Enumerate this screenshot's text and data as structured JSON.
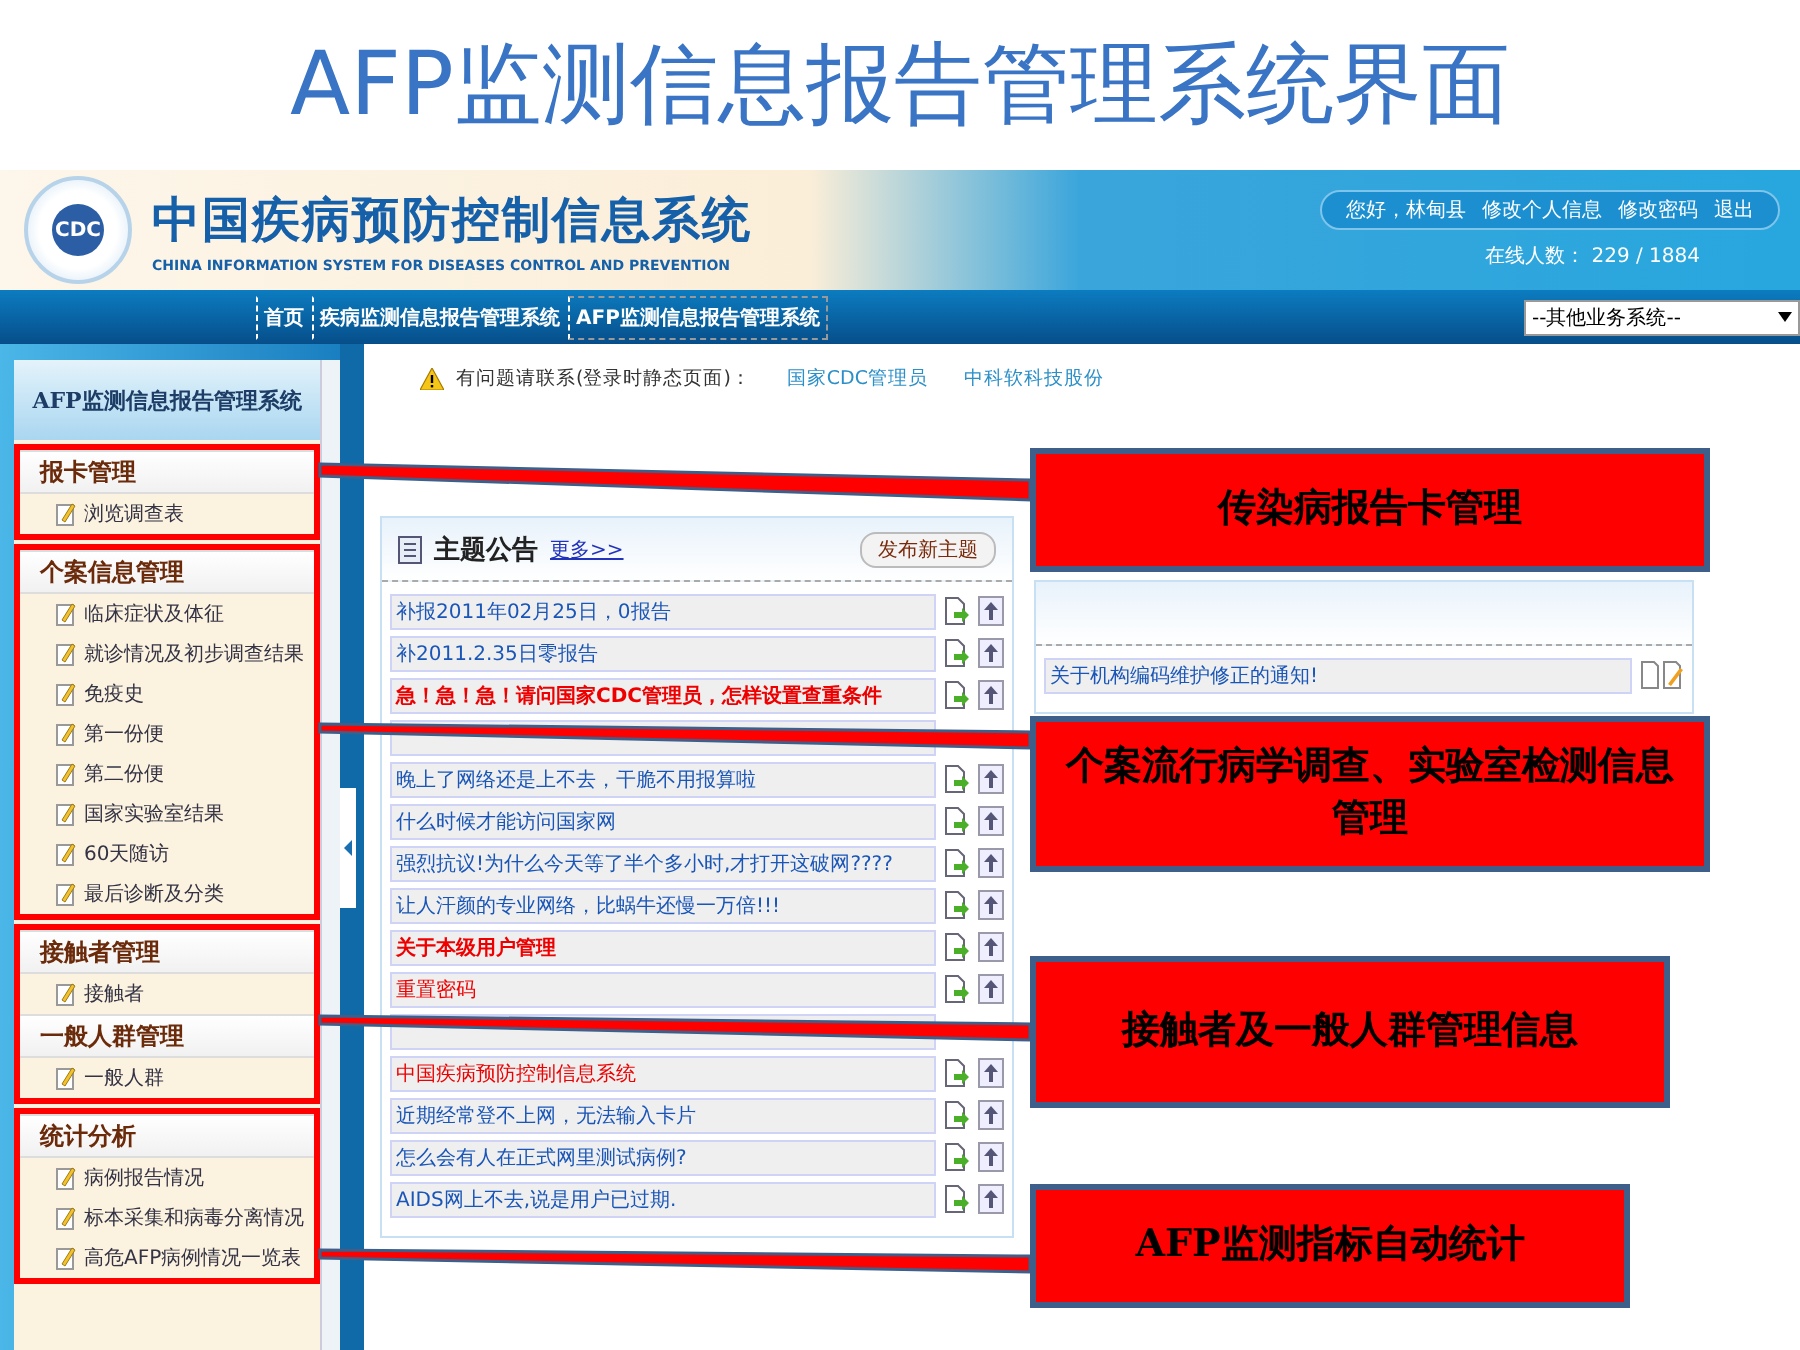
{
  "slide_title": "AFP监测信息报告管理系统界面",
  "header": {
    "title": "中国疾病预防控制信息系统",
    "subtitle": "CHINA INFORMATION SYSTEM FOR DISEASES CONTROL AND PREVENTION",
    "logo_text": "CDC",
    "user_links": [
      "您好，林甸县",
      "修改个人信息",
      "修改密码",
      "退出"
    ],
    "online": "在线人数： 229 / 1884"
  },
  "nav": {
    "items": [
      {
        "label": "首页",
        "selected": false
      },
      {
        "label": "疾病监测信息报告管理系统",
        "selected": false
      },
      {
        "label": "AFP监测信息报告管理系统",
        "selected": true
      }
    ],
    "select": "--其他业务系统--"
  },
  "sidebar": {
    "title": "AFP监测信息报告管理系统",
    "sections": [
      {
        "groups": [
          {
            "title": "报卡管理",
            "items": [
              "浏览调查表"
            ]
          }
        ]
      },
      {
        "groups": [
          {
            "title": "个案信息管理",
            "items": [
              "临床症状及体征",
              "就诊情况及初步调查结果",
              "免疫史",
              "第一份便",
              "第二份便",
              "国家实验室结果",
              "60天随访",
              "最后诊断及分类"
            ]
          }
        ]
      },
      {
        "groups": [
          {
            "title": "接触者管理",
            "items": [
              "接触者"
            ]
          },
          {
            "title": "一般人群管理",
            "items": [
              "一般人群"
            ]
          }
        ]
      },
      {
        "groups": [
          {
            "title": "统计分析",
            "items": [
              "病例报告情况",
              "标本采集和病毒分离情况",
              "高危AFP病例情况一览表"
            ]
          }
        ]
      }
    ]
  },
  "notice": {
    "text": "有问题请联系(登录时静态页面)：",
    "links": [
      "国家CDC管理员",
      "中科软科技股份"
    ]
  },
  "topics": {
    "title": "主题公告",
    "more": "更多>>",
    "new_button": "发布新主题",
    "rows": [
      {
        "kind": "topic",
        "title": "补报2011年02月25日，0报告",
        "color": "#1a56b8",
        "bold": false
      },
      {
        "kind": "topic",
        "title": "补2011.2.35日零报告",
        "color": "#1a56b8",
        "bold": false
      },
      {
        "kind": "topic",
        "title": "急！急！急！请问国家CDC管理员，怎样设置查重条件",
        "color": "#ee0000",
        "bold": true
      },
      {
        "kind": "blank"
      },
      {
        "kind": "topic",
        "title": "晚上了网络还是上不去，干脆不用报算啦",
        "color": "#1a56b8",
        "bold": false
      },
      {
        "kind": "topic",
        "title": "什么时候才能访问国家网",
        "color": "#1a56b8",
        "bold": false
      },
      {
        "kind": "topic",
        "title": "强烈抗议!为什么今天等了半个多小时,才打开这破网????",
        "color": "#1a56b8",
        "bold": false
      },
      {
        "kind": "topic",
        "title": "让人汗颜的专业网络，比蜗牛还慢一万倍!!!",
        "color": "#1a56b8",
        "bold": false
      },
      {
        "kind": "topic",
        "title": "关于本级用户管理",
        "color": "#ee0000",
        "bold": true
      },
      {
        "kind": "topic",
        "title": "重置密码",
        "color": "#ee0000",
        "bold": false
      },
      {
        "kind": "blank"
      },
      {
        "kind": "topic",
        "title": "中国疾病预防控制信息系统",
        "color": "#ee0000",
        "bold": false
      },
      {
        "kind": "topic",
        "title": "近期经常登不上网，无法输入卡片",
        "color": "#1a56b8",
        "bold": false
      },
      {
        "kind": "topic",
        "title": "怎么会有人在正式网里测试病例?",
        "color": "#1a56b8",
        "bold": false
      },
      {
        "kind": "topic",
        "title": "AIDS网上不去,说是用户已过期.",
        "color": "#1a56b8",
        "bold": false
      }
    ]
  },
  "notices": {
    "rows": [
      "关于机构编码维护修正的通知!"
    ]
  },
  "callouts": [
    "传染病报告卡管理",
    "个案流行病学调查、实验室检测信息管理",
    "接触者及一般人群管理信息",
    "AFP监测指标自动统计"
  ]
}
